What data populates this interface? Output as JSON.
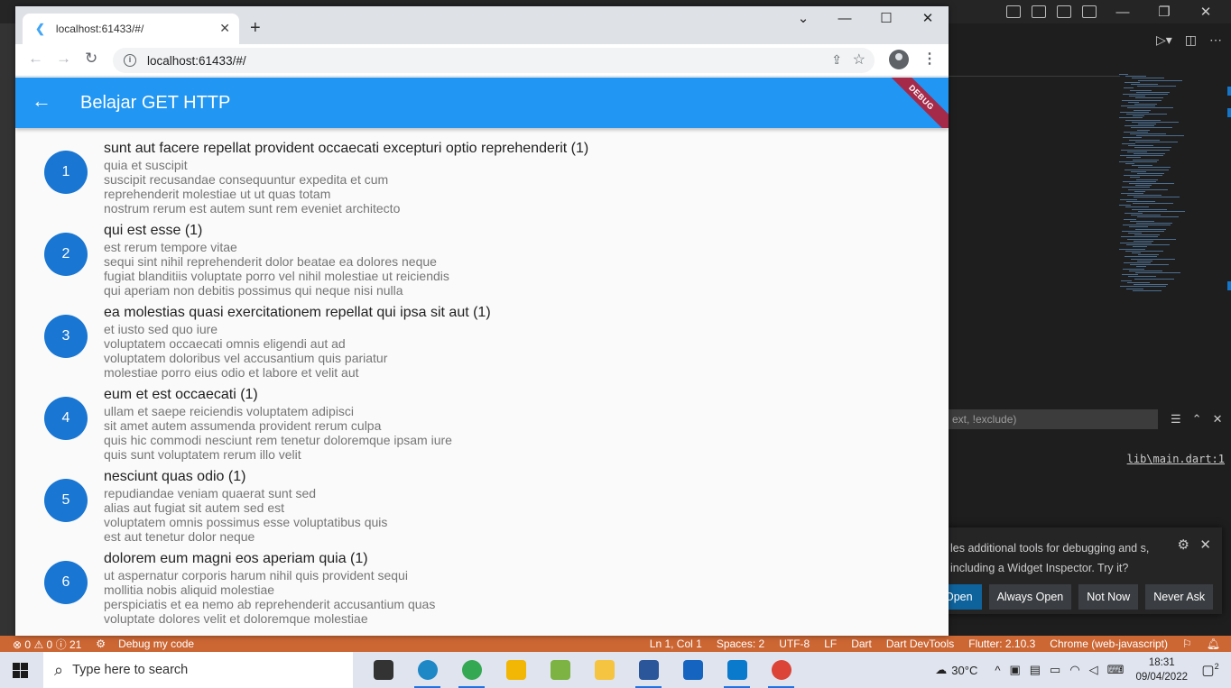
{
  "chrome": {
    "tab_title": "localhost:61433/#/",
    "address": "localhost:61433/#/"
  },
  "app": {
    "title": "Belajar GET HTTP",
    "debug_banner": "DEBUG",
    "posts": [
      {
        "id": "1",
        "title": "sunt aut facere repellat provident occaecati excepturi optio reprehenderit (1)",
        "body": "quia et suscipit\nsuscipit recusandae consequuntur expedita et cum\nreprehenderit molestiae ut ut quas totam\nnostrum rerum est autem sunt rem eveniet architecto"
      },
      {
        "id": "2",
        "title": "qui est esse (1)",
        "body": "est rerum tempore vitae\nsequi sint nihil reprehenderit dolor beatae ea dolores neque\nfugiat blanditiis voluptate porro vel nihil molestiae ut reiciendis\nqui aperiam non debitis possimus qui neque nisi nulla"
      },
      {
        "id": "3",
        "title": "ea molestias quasi exercitationem repellat qui ipsa sit aut (1)",
        "body": "et iusto sed quo iure\nvoluptatem occaecati omnis eligendi aut ad\nvoluptatem doloribus vel accusantium quis pariatur\nmolestiae porro eius odio et labore et velit aut"
      },
      {
        "id": "4",
        "title": "eum et est occaecati (1)",
        "body": "ullam et saepe reiciendis voluptatem adipisci\nsit amet autem assumenda provident rerum culpa\nquis hic commodi nesciunt rem tenetur doloremque ipsam iure\nquis sunt voluptatem rerum illo velit"
      },
      {
        "id": "5",
        "title": "nesciunt quas odio (1)",
        "body": "repudiandae veniam quaerat sunt sed\nalias aut fugiat sit autem sed est\nvoluptatem omnis possimus esse voluptatibus quis\nest aut tenetur dolor neque"
      },
      {
        "id": "6",
        "title": "dolorem eum magni eos aperiam quia (1)",
        "body": "ut aspernatur corporis harum nihil quis provident sequi\nmollitia nobis aliquid molestiae\nperspiciatis et ea nemo ab reprehenderit accusantium quas\nvoluptate dolores velit et doloremque molestiae"
      }
    ]
  },
  "vscode": {
    "filter_placeholder": "ext, !exclude)",
    "debug_location": "lib\\main.dart:1",
    "notification": {
      "message": "les additional tools for debugging and s, including a Widget Inspector. Try it?",
      "buttons": [
        "Open",
        "Always Open",
        "Not Now",
        "Never Ask"
      ]
    },
    "status": {
      "errors": "0",
      "warnings": "0",
      "info": "21",
      "debug": "Debug my code",
      "position": "Ln 1, Col 1",
      "spaces": "Spaces: 2",
      "encoding": "UTF-8",
      "eol": "LF",
      "language": "Dart",
      "devtools": "Dart DevTools",
      "flutter": "Flutter: 2.10.3",
      "device": "Chrome (web-javascript)"
    }
  },
  "taskbar": {
    "search_placeholder": "Type here to search",
    "temperature": "30°C",
    "time": "18:31",
    "date": "09/04/2022",
    "notification_count": "2",
    "apps": [
      {
        "name": "task-view",
        "color": "#333333"
      },
      {
        "name": "edge",
        "color": "#1e88c7"
      },
      {
        "name": "chrome",
        "color": "#34a853"
      },
      {
        "name": "file-explorer",
        "color": "#f2b705"
      },
      {
        "name": "chart-app",
        "color": "#7cb342"
      },
      {
        "name": "tool-app",
        "color": "#f5c542"
      },
      {
        "name": "word",
        "color": "#2b579a"
      },
      {
        "name": "photos",
        "color": "#1565c0"
      },
      {
        "name": "vscode",
        "color": "#0a7acc"
      },
      {
        "name": "chrome-active",
        "color": "#db4437"
      }
    ]
  }
}
